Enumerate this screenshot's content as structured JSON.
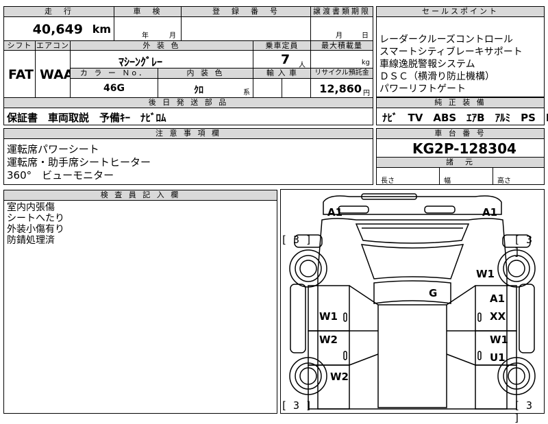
{
  "top": {
    "mileage_header": "走　行",
    "inspection_header": "車　検",
    "reg_header": "登　録　番　号",
    "transfer_header": "譲渡書類期限",
    "sales_header": "セールスポイント"
  },
  "mileage": {
    "value": "40,649",
    "unit": "km"
  },
  "inspection": {
    "year_label": "年",
    "month_label": "月"
  },
  "transfer": {
    "month_label": "月",
    "day_label": "日"
  },
  "sales_points": [
    "レーダークルーズコントロール",
    "スマートシティブレーキサポート",
    "車線逸脱警報システム",
    "ＤＳＣ（横滑り防止機構）",
    "パワーリフトゲート"
  ],
  "row2": {
    "shift_header": "シフト",
    "ac_header": "エアコン",
    "exterior_header": "外 装 色",
    "capacity_header": "乗車定員",
    "maxload_header": "最大積載量"
  },
  "shift": "FAT",
  "ac": "WAA",
  "exterior_color": "ﾏｼｰﾝｸﾞﾚｰ",
  "capacity": {
    "value": "7",
    "unit": "人"
  },
  "maxload": {
    "unit": "kg"
  },
  "row3": {
    "color_no_header": "カ ラ ー Ｎo．",
    "interior_header": "内 装 色",
    "import_header": "輸 入 車",
    "recycle_header": "リサイクル預託金"
  },
  "color_no": "46G",
  "interior": {
    "value": "ｸﾛ",
    "suffix": "系"
  },
  "recycle": {
    "value": "12,860",
    "unit": "円"
  },
  "later_parts": {
    "header": "後 日 発 送 部 品",
    "value": "保証書　車両取説　予備ｷｰ　ﾅﾋﾞﾛﾑ"
  },
  "genuine_equipment": {
    "header": "純 正 装 備",
    "items": "ﾅﾋﾞ　TV　ABS　ｴｱB　ｱﾙﾐ　PS　PW"
  },
  "notes": {
    "header": "注 意 事 項 欄",
    "lines": [
      "運転席パワーシート",
      "運転席・助手席シートヒーター",
      "360°　ビューモニター"
    ]
  },
  "chassis": {
    "header": "車 台 番 号",
    "value": "KG2P-128304"
  },
  "dimensions": {
    "header": "諸　元",
    "length_label": "長さ",
    "width_label": "幅",
    "height_label": "高さ"
  },
  "inspector": {
    "header": "検 査 員 記 入 欄",
    "lines": [
      "室内内張傷",
      "シートへたり",
      "外装小傷有り",
      "防錆処理済"
    ]
  },
  "diagram": {
    "marks": {
      "a1_left": "A1",
      "a1_right": "A1",
      "w1_right_fender": "W1",
      "g": "G",
      "a1_door": "A1",
      "xx": "XX",
      "w1_left_front_door": "W1",
      "w2_left_rear_door": "W2",
      "w1_right_rear_door": "W1",
      "u1": "U1",
      "w2_left_lower": "W2"
    },
    "brackets": {
      "top_left": "[ 3 ]",
      "top_right": "[ 3 ]",
      "bottom_left": "[ 3 ]",
      "bottom_right": "[ 3 ]"
    }
  }
}
